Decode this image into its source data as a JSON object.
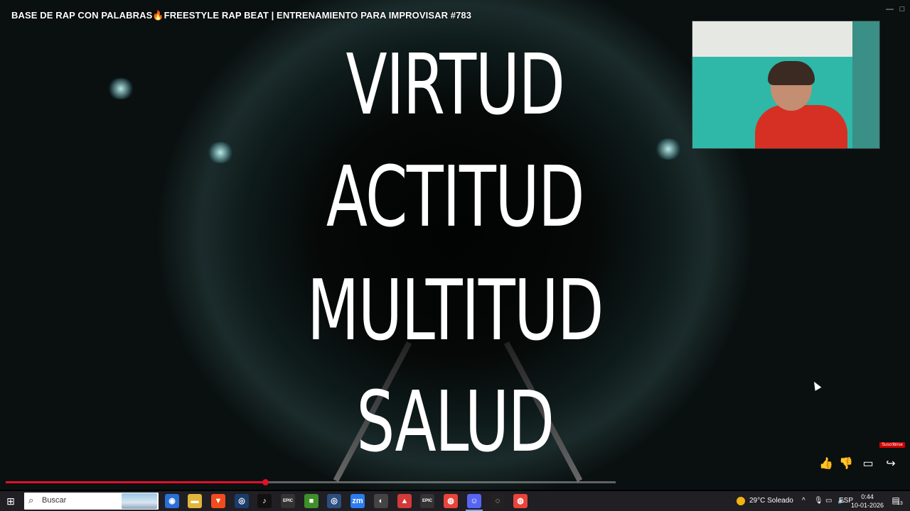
{
  "video": {
    "title": "BASE DE RAP CON PALABRAS🔥FREESTYLE RAP BEAT | ENTRENAMIENTO PARA IMPROVISAR #783",
    "words": [
      "VIRTUD",
      "ACTITUD",
      "MULTITUD",
      "SALUD"
    ],
    "subscribe_label": "Suscribirse",
    "progress_fraction": 0.425,
    "window_controls": [
      "—",
      "□"
    ]
  },
  "actions": {
    "like_icon": "thumbs-up-icon",
    "dislike_icon": "thumbs-down-icon",
    "comments_icon": "comment-icon",
    "share_icon": "share-icon"
  },
  "taskbar": {
    "search_placeholder": "Buscar",
    "apps": [
      {
        "name": "app-icon-1",
        "glyph": "◉",
        "color": "#2a6fd6"
      },
      {
        "name": "file-explorer-icon",
        "glyph": "▬",
        "color": "#e2b53b"
      },
      {
        "name": "brave-icon",
        "glyph": "▼",
        "color": "#f24b1e"
      },
      {
        "name": "steam-icon",
        "glyph": "◎",
        "color": "#1b3c6b"
      },
      {
        "name": "tiktok-icon",
        "glyph": "♪",
        "color": "#111111"
      },
      {
        "name": "epic-games-icon",
        "glyph": "EPIC",
        "color": "#333333"
      },
      {
        "name": "minecraft-icon",
        "glyph": "■",
        "color": "#3f8f2a"
      },
      {
        "name": "steam-icon-2",
        "glyph": "◎",
        "color": "#2c4f80"
      },
      {
        "name": "zoom-icon",
        "glyph": "zm",
        "color": "#2b7cf0"
      },
      {
        "name": "app-icon-2",
        "glyph": "◐",
        "color": "#444444"
      },
      {
        "name": "app-icon-3",
        "glyph": "▲",
        "color": "#d43a3a"
      },
      {
        "name": "epic-games-icon-2",
        "glyph": "EPIC",
        "color": "#333333"
      },
      {
        "name": "chrome-icon",
        "glyph": "◍",
        "color": "#e8443a"
      },
      {
        "name": "discord-icon",
        "glyph": "☺",
        "color": "#5865f2"
      },
      {
        "name": "obs-icon",
        "glyph": "◌",
        "color": "#222222"
      },
      {
        "name": "chrome-icon-2",
        "glyph": "◍",
        "color": "#e8443a"
      }
    ],
    "weather": "29°C  Soleado",
    "language": "ESP",
    "time": "0:44",
    "date": "10-01-2026",
    "notifications_count": "13"
  }
}
